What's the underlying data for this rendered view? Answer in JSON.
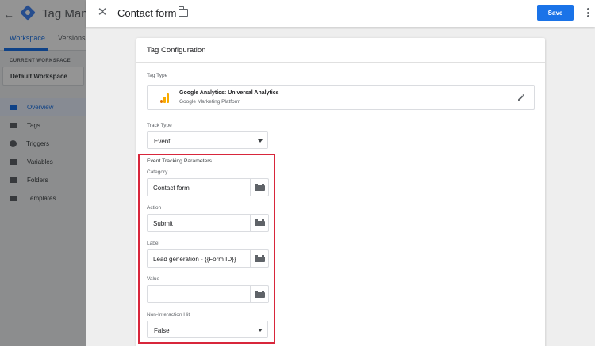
{
  "background_app": {
    "title": "Tag Manager",
    "tabs": [
      {
        "label": "Workspace"
      },
      {
        "label": "Versions"
      }
    ],
    "workspace_label": "CURRENT WORKSPACE",
    "workspace_name": "Default Workspace",
    "nav": [
      {
        "label": "Overview",
        "icon": "overview-icon",
        "active": true
      },
      {
        "label": "Tags",
        "icon": "tag-icon"
      },
      {
        "label": "Triggers",
        "icon": "trigger-icon"
      },
      {
        "label": "Variables",
        "icon": "variables-icon"
      },
      {
        "label": "Folders",
        "icon": "folder-icon"
      },
      {
        "label": "Templates",
        "icon": "template-icon"
      }
    ]
  },
  "header": {
    "title": "Contact form",
    "save_label": "Save",
    "accent_color": "#1a73e8"
  },
  "card": {
    "title": "Tag Configuration",
    "tag_type_label": "Tag Type",
    "tag_type_name": "Google Analytics: Universal Analytics",
    "tag_type_vendor": "Google Marketing Platform",
    "track_type_label": "Track Type",
    "track_type_value": "Event",
    "event_params": {
      "section_title": "Event Tracking Parameters",
      "highlight_color": "#d8263b",
      "category_label": "Category",
      "category_value": "Contact form",
      "action_label": "Action",
      "action_value": "Submit",
      "label_label": "Label",
      "label_value": "Lead generation - {{Form ID}}",
      "value_label": "Value",
      "value_value": "",
      "non_interaction_label": "Non-Interaction Hit",
      "non_interaction_value": "False"
    }
  }
}
